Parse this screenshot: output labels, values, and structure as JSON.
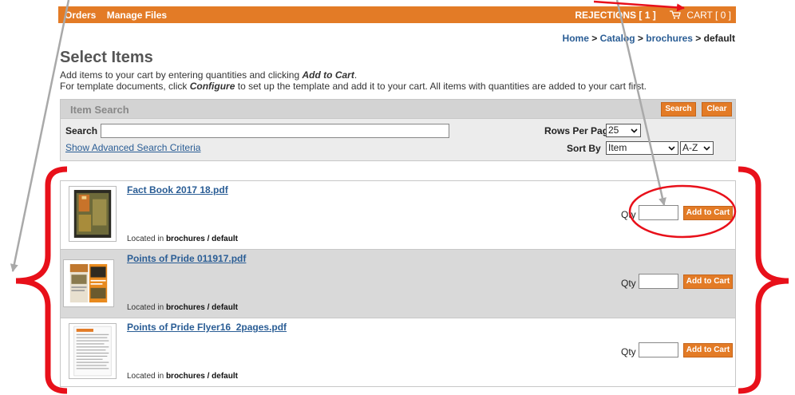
{
  "nav": {
    "orders": "Orders",
    "manage_files": "Manage Files",
    "rejections": "REJECTIONS [ 1 ]",
    "cart": "CART [ 0 ]"
  },
  "breadcrumb": {
    "home": "Home",
    "catalog": "Catalog",
    "brochures": "brochures",
    "current": "default",
    "separator": " > "
  },
  "page": {
    "title": "Select Items",
    "line1_pre": "Add items to your cart by entering quantities and clicking ",
    "line1_em": "Add to Cart",
    "line1_post": ".",
    "line2_pre": "For template documents, click ",
    "line2_em": "Configure",
    "line2_post": " to set up the template and add it to your cart. All items with quantities are added to your cart first."
  },
  "search": {
    "header": "Item Search",
    "search_button": "Search",
    "clear_button": "Clear",
    "search_label": "Search",
    "search_value": "",
    "advanced_link": "Show Advanced Search Criteria",
    "rows_label": "Rows Per Page",
    "rows_value": "25",
    "sort_label": "Sort By",
    "sort_value": "Item",
    "order_value": "A-Z"
  },
  "items": [
    {
      "name": "Fact Book 2017 18.pdf",
      "loc_prefix": "Located in ",
      "location": "brochures / default",
      "qty_label": "Qty",
      "qty_value": "",
      "add_label": "Add to Cart"
    },
    {
      "name": "Points of Pride 011917.pdf",
      "loc_prefix": "Located in ",
      "location": "brochures / default",
      "qty_label": "Qty",
      "qty_value": "",
      "add_label": "Add to Cart"
    },
    {
      "name": "Points of Pride Flyer16_2pages.pdf",
      "loc_prefix": "Located in ",
      "location": "brochures / default",
      "qty_label": "Qty",
      "qty_value": "",
      "add_label": "Add to Cart"
    }
  ],
  "colors": {
    "accent": "#e37b26",
    "link": "#2a5d95",
    "annotation": "#e8101a",
    "pointer": "#a9a9a9"
  }
}
